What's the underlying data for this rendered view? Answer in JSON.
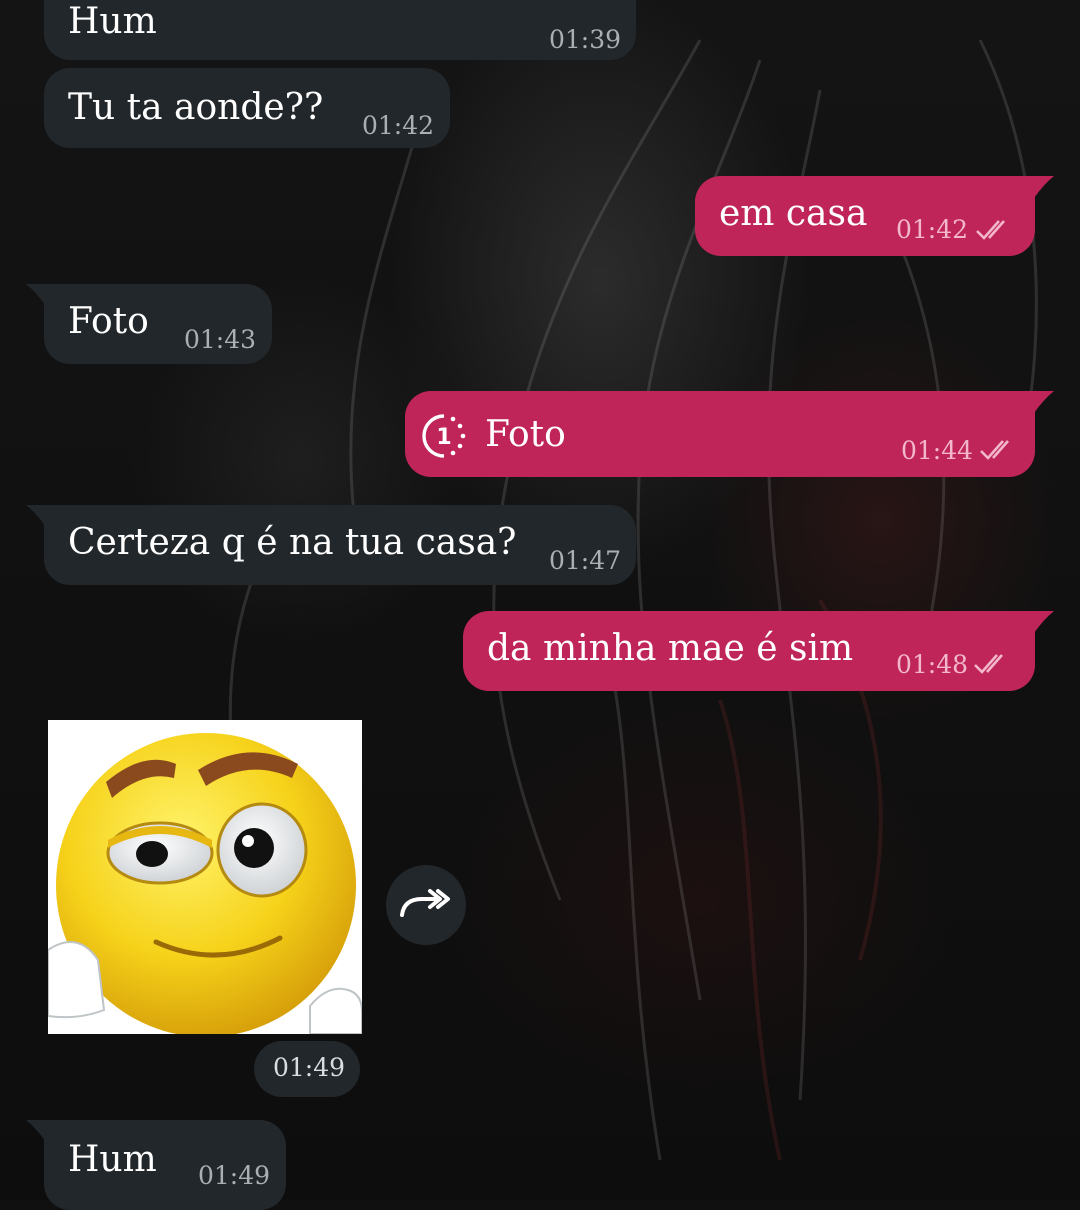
{
  "messages": [
    {
      "id": "m1",
      "direction": "incoming",
      "text": "Hum",
      "time": "01:39"
    },
    {
      "id": "m2",
      "direction": "incoming",
      "text": "Tu ta aonde??",
      "time": "01:42"
    },
    {
      "id": "m3",
      "direction": "outgoing",
      "text": "em casa",
      "time": "01:42",
      "status": "read"
    },
    {
      "id": "m4",
      "direction": "incoming",
      "text": "Foto",
      "time": "01:43"
    },
    {
      "id": "m5",
      "direction": "outgoing",
      "text": "Foto",
      "time": "01:44",
      "status": "read",
      "icon": "view-once-icon",
      "view_once_count": "1"
    },
    {
      "id": "m6",
      "direction": "incoming",
      "text": "Certeza q é na tua casa?",
      "time": "01:47"
    },
    {
      "id": "m7",
      "direction": "outgoing",
      "text": "da minha mae é sim",
      "time": "01:48",
      "status": "read"
    },
    {
      "id": "m8",
      "direction": "incoming",
      "type": "image",
      "image": "smirking-emoji-meme",
      "time": "01:49",
      "action_icon": "forward-icon"
    },
    {
      "id": "m9",
      "direction": "incoming",
      "text": "Hum",
      "time": "01:49"
    }
  ],
  "colors": {
    "incoming_bubble": "#22272b",
    "outgoing_bubble": "#c0255a",
    "timestamp_incoming": "#a9b0b5",
    "timestamp_outgoing": "#f2b7ca"
  }
}
